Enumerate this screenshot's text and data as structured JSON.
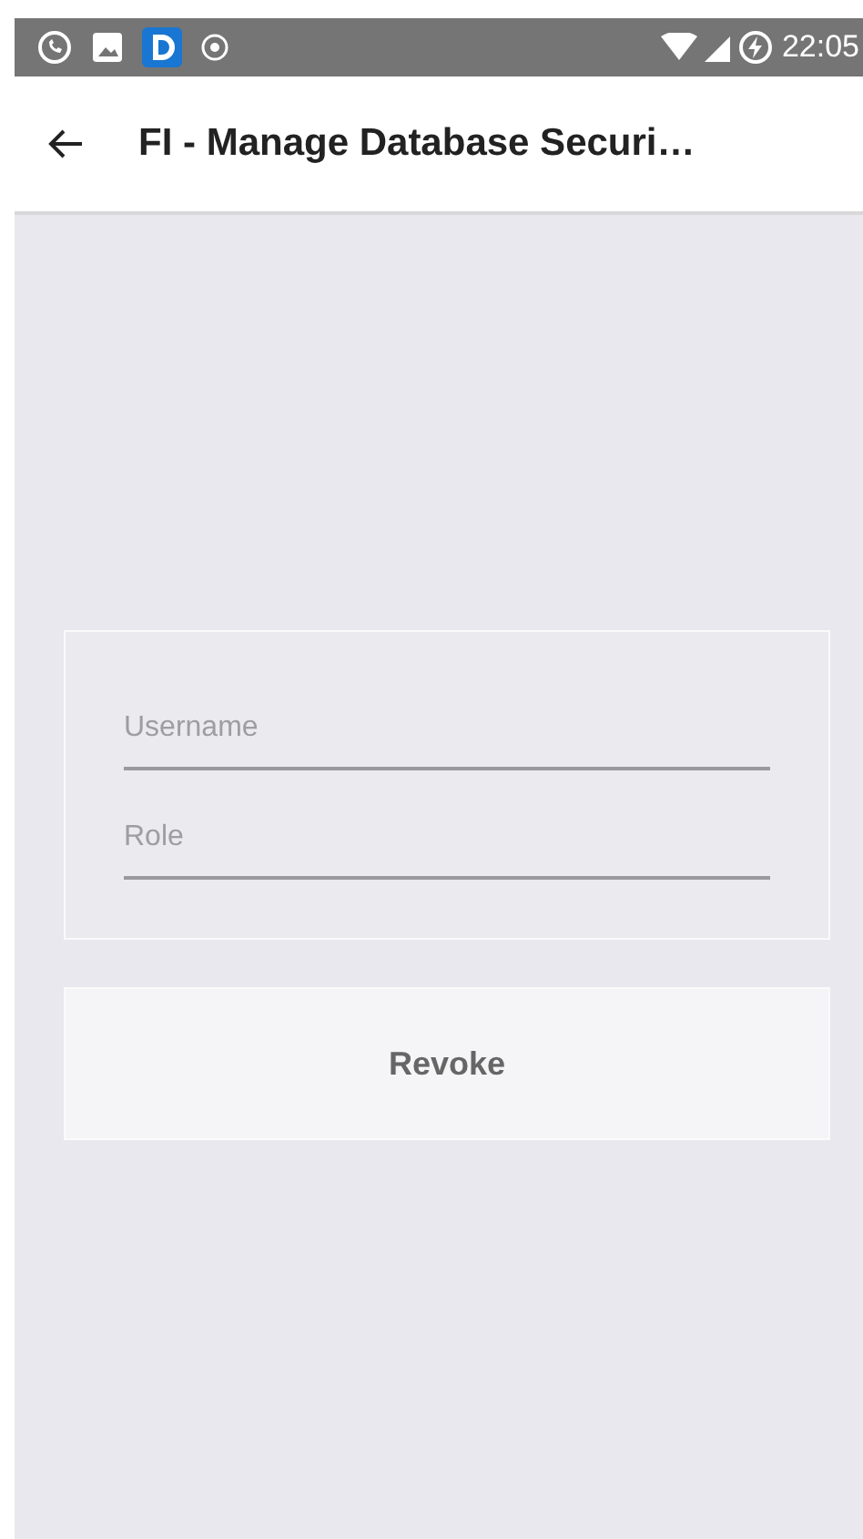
{
  "status_bar": {
    "time": "22:05"
  },
  "app_bar": {
    "title": "FI - Manage Database Securi…"
  },
  "form": {
    "fields": [
      {
        "placeholder": "Username"
      },
      {
        "placeholder": "Role"
      }
    ]
  },
  "buttons": [
    {
      "label": "Revoke"
    }
  ]
}
